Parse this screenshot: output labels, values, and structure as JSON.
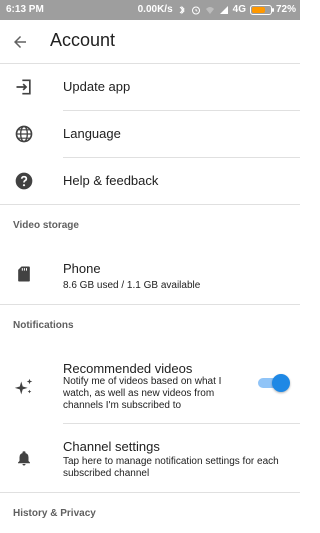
{
  "status_bar": {
    "time": "6:13 PM",
    "speed": "0.00K/s",
    "network": "4G",
    "battery": "72%",
    "battery_level": 0.72,
    "battery_color": "#ff9800"
  },
  "app_bar": {
    "title": "Account",
    "back_icon": "arrow-back-icon"
  },
  "menu": {
    "update_app": {
      "label": "Update app",
      "icon": "update-app-icon"
    },
    "language": {
      "label": "Language",
      "icon": "globe-icon"
    },
    "help": {
      "label": "Help & feedback",
      "icon": "help-icon"
    }
  },
  "video_storage": {
    "header": "Video storage",
    "phone": {
      "label": "Phone",
      "detail": "8.6 GB used / 1.1 GB available",
      "icon": "sd-card-icon"
    }
  },
  "notifications": {
    "header": "Notifications",
    "recommended": {
      "label": "Recommended videos",
      "detail": "Notify me of videos based on what I watch, as well as new videos from channels I'm subscribed to",
      "icon": "sparkle-icon",
      "enabled": true
    },
    "channel_settings": {
      "label": "Channel settings",
      "detail": "Tap here to manage notification settings for each subscribed channel",
      "icon": "bell-icon"
    }
  },
  "history_privacy": {
    "header": "History & Privacy"
  },
  "colors": {
    "toggle_on_thumb": "#1e88e5",
    "toggle_on_track": "#90c4f7",
    "status_bar_bg": "#9e9e9e"
  }
}
